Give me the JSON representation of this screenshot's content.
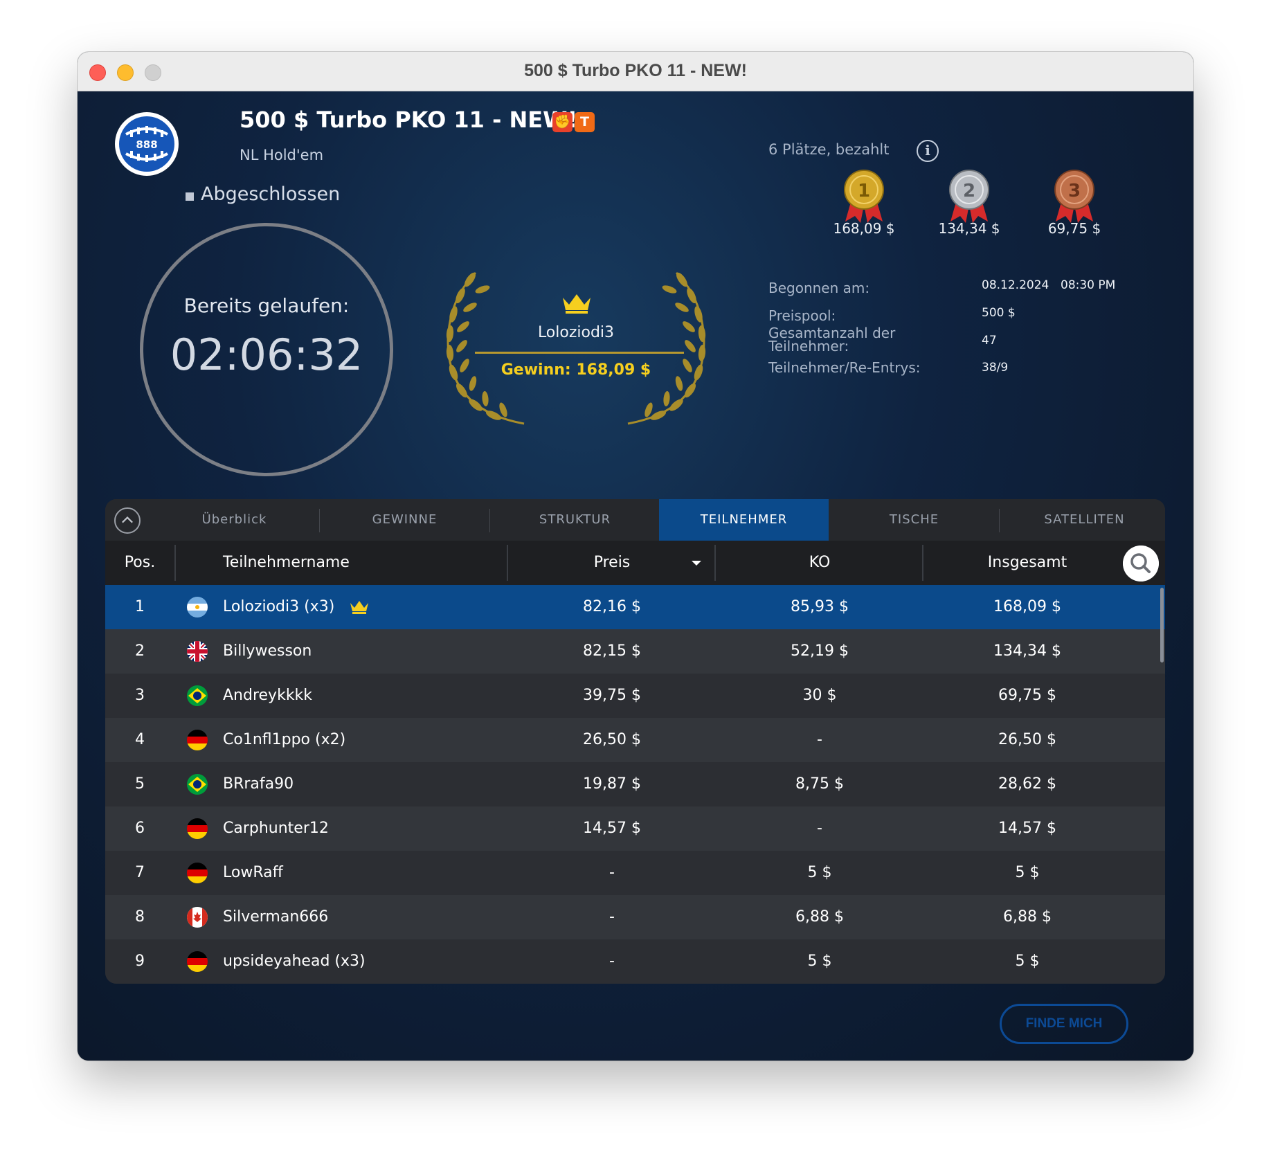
{
  "window": {
    "title": "500 $ Turbo PKO 11 - NEW!"
  },
  "tournament": {
    "title": "500 $ Turbo PKO 11 - NEW!",
    "game_type": "NL Hold'em",
    "status": "Abgeschlossen",
    "badges": [
      "knockout-badge-icon",
      "turbo-badge-icon"
    ],
    "logo_text": "888"
  },
  "timer": {
    "label": "Bereits gelaufen:",
    "value": "02:06:32"
  },
  "winner": {
    "name": "Loloziodi3",
    "amount": "Gewinn: 168,09 $"
  },
  "payouts": {
    "places_label": "6 Plätze, bezahlt",
    "medals": [
      {
        "rank": "1",
        "amount": "168,09 $",
        "color": "#d4a82a"
      },
      {
        "rank": "2",
        "amount": "134,34 $",
        "color": "#b8bcc2"
      },
      {
        "rank": "3",
        "amount": "69,75 $",
        "color": "#c0704a"
      }
    ]
  },
  "details": {
    "started_label": "Begonnen am:",
    "started_date": "08.12.2024",
    "started_time": "08:30 PM",
    "prizepool_label": "Preispool:",
    "prizepool_value": "500 $",
    "participants_label_1": "Gesamtanzahl der",
    "participants_label_2": "Teilnehmer:",
    "participants_value": "47",
    "reentries_label": "Teilnehmer/Re-Entrys:",
    "reentries_value": "38/9"
  },
  "tabs": [
    {
      "label": "Überblick",
      "active": false
    },
    {
      "label": "GEWINNE",
      "active": false
    },
    {
      "label": "STRUKTUR",
      "active": false
    },
    {
      "label": "TEILNEHMER",
      "active": true
    },
    {
      "label": "TISCHE",
      "active": false
    },
    {
      "label": "SATELLITEN",
      "active": false
    }
  ],
  "table": {
    "columns": {
      "pos": "Pos.",
      "name": "Teilnehmername",
      "preis": "Preis",
      "ko": "KO",
      "total": "Insgesamt"
    },
    "rows": [
      {
        "pos": "1",
        "flag": "argentina-flag-icon",
        "name": "Loloziodi3 (x3)",
        "crown": true,
        "preis": "82,16 $",
        "ko": "85,93 $",
        "total": "168,09 $",
        "selected": true
      },
      {
        "pos": "2",
        "flag": "uk-flag-icon",
        "name": "Billywesson",
        "crown": false,
        "preis": "82,15 $",
        "ko": "52,19 $",
        "total": "134,34 $",
        "selected": false
      },
      {
        "pos": "3",
        "flag": "brazil-flag-icon",
        "name": "Andreykkkk",
        "crown": false,
        "preis": "39,75 $",
        "ko": "30 $",
        "total": "69,75 $",
        "selected": false
      },
      {
        "pos": "4",
        "flag": "germany-flag-icon",
        "name": "Co1nfl1ppo (x2)",
        "crown": false,
        "preis": "26,50 $",
        "ko": "-",
        "total": "26,50 $",
        "selected": false
      },
      {
        "pos": "5",
        "flag": "brazil-flag-icon",
        "name": "BRrafa90",
        "crown": false,
        "preis": "19,87 $",
        "ko": "8,75 $",
        "total": "28,62 $",
        "selected": false
      },
      {
        "pos": "6",
        "flag": "germany-flag-icon",
        "name": "Carphunter12",
        "crown": false,
        "preis": "14,57 $",
        "ko": "-",
        "total": "14,57 $",
        "selected": false
      },
      {
        "pos": "7",
        "flag": "germany-flag-icon",
        "name": "LowRaff",
        "crown": false,
        "preis": "-",
        "ko": "5 $",
        "total": "5 $",
        "selected": false
      },
      {
        "pos": "8",
        "flag": "canada-flag-icon",
        "name": "Silverman666",
        "crown": false,
        "preis": "-",
        "ko": "6,88 $",
        "total": "6,88 $",
        "selected": false
      },
      {
        "pos": "9",
        "flag": "germany-flag-icon",
        "name": "upsideyahead (x3)",
        "crown": false,
        "preis": "-",
        "ko": "5 $",
        "total": "5 $",
        "selected": false
      }
    ]
  },
  "find_me": {
    "label": "FINDE MICH"
  }
}
